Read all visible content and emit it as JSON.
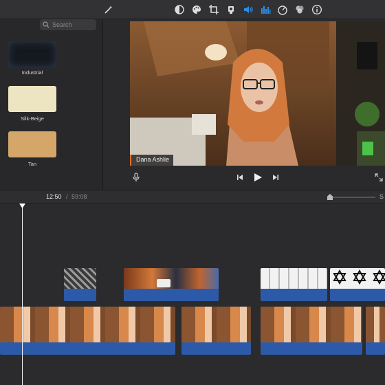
{
  "toolbar": {
    "icons": [
      "magic-wand-icon",
      "color-balance-icon",
      "palette-icon",
      "crop-icon",
      "camera-stabilize-icon",
      "volume-icon",
      "equalizer-icon",
      "speed-icon",
      "filter-icon",
      "info-icon"
    ],
    "active_icon": "volume-icon",
    "accent": "#2f8ce6"
  },
  "browser": {
    "search": {
      "placeholder": "Search",
      "value": ""
    },
    "backgrounds": [
      {
        "label": "Industrial",
        "color": "#15191f"
      },
      {
        "label": "Silk-Beige",
        "color": "#ede4c2"
      },
      {
        "label": "Tan",
        "color": "#d4a66a"
      }
    ]
  },
  "viewer": {
    "name_tag": "Dana Ashlie"
  },
  "timeline": {
    "current_time": "12:50",
    "separator": "/",
    "total_time": "59:08",
    "right_cut_label": "S"
  },
  "colors": {
    "audio": "#2d5aa8",
    "name_tag_accent": "#e07020"
  }
}
